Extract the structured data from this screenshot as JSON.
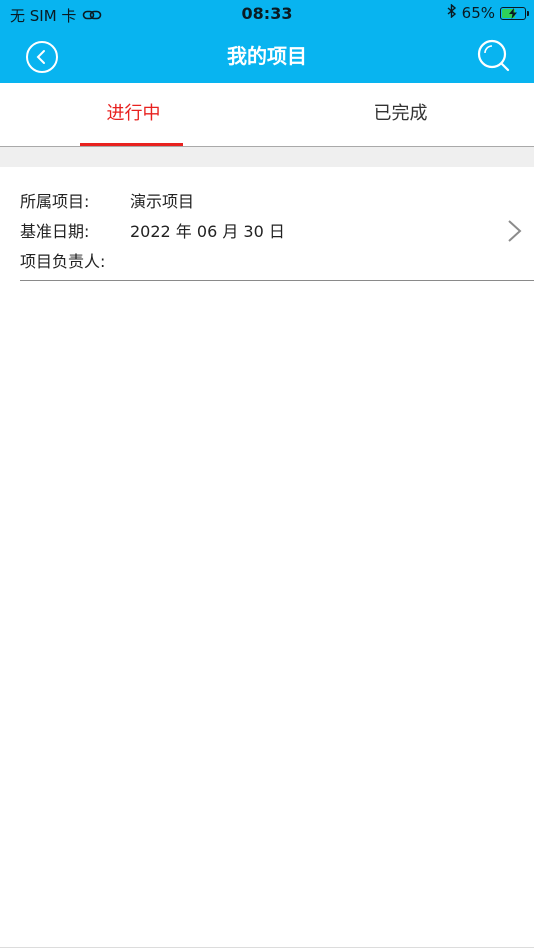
{
  "status_bar": {
    "carrier": "无 SIM 卡",
    "time": "08:33",
    "battery_percent": "65%",
    "battery_level": 0.65,
    "icons": [
      "link-icon",
      "bluetooth-icon",
      "battery-charging-icon"
    ]
  },
  "nav": {
    "title": "我的项目",
    "back_icon": "back-icon",
    "search_icon": "search-icon"
  },
  "tabs": [
    {
      "label": "进行中",
      "active": true
    },
    {
      "label": "已完成",
      "active": false
    }
  ],
  "projects": [
    {
      "project_label": "所属项目:",
      "project_value": "演示项目",
      "date_label": "基准日期:",
      "date_value": "2022 年 06 月 30 日",
      "owner_label": "项目负责人:",
      "owner_value": ""
    }
  ],
  "colors": {
    "header_bg": "#08b4f0",
    "active_tab": "#e8211f",
    "text": "#222222",
    "separator_band": "#efefef"
  }
}
